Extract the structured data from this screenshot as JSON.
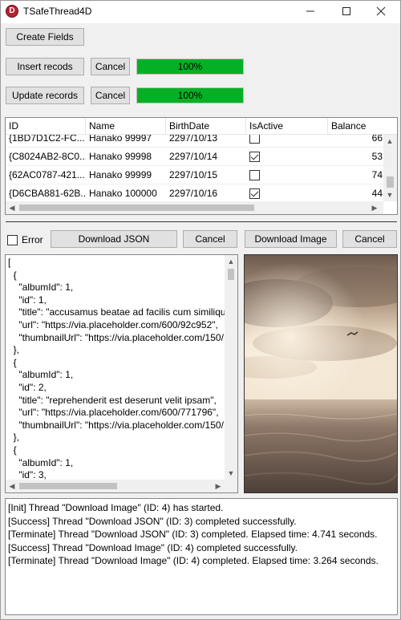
{
  "window": {
    "title": "TSafeThread4D",
    "minimize": "—",
    "maximize": "☐",
    "close": "✕"
  },
  "buttons": {
    "create_fields": "Create Fields",
    "insert_records": "Insert recods",
    "insert_cancel": "Cancel",
    "update_records": "Update records",
    "update_cancel": "Cancel",
    "download_json": "Download JSON",
    "json_cancel": "Cancel",
    "download_image": "Download Image",
    "image_cancel": "Cancel"
  },
  "progress": {
    "insert": {
      "value": 1.0,
      "label": "100%"
    },
    "update": {
      "value": 1.0,
      "label": "100%"
    }
  },
  "grid": {
    "columns": [
      "ID",
      "Name",
      "BirthDate",
      "IsActive",
      "Balance"
    ],
    "rows": [
      {
        "id": "{1BD7D1C2-FC...",
        "name": "Hanako 99997",
        "birthdate": "2297/10/13",
        "active": false,
        "balance": "66"
      },
      {
        "id": "{C8024AB2-8C0...",
        "name": "Hanako 99998",
        "birthdate": "2297/10/14",
        "active": true,
        "balance": "53"
      },
      {
        "id": "{62AC0787-421...",
        "name": "Hanako 99999",
        "birthdate": "2297/10/15",
        "active": false,
        "balance": "74"
      },
      {
        "id": "{D6CBA881-62B...",
        "name": "Hanako 100000",
        "birthdate": "2297/10/16",
        "active": true,
        "balance": "44"
      }
    ]
  },
  "error_checkbox": {
    "label": "Error",
    "checked": false
  },
  "json_text": "[\n  {\n    \"albumId\": 1,\n    \"id\": 1,\n    \"title\": \"accusamus beatae ad facilis cum similique\n    \"url\": \"https://via.placeholder.com/600/92c952\",\n    \"thumbnailUrl\": \"https://via.placeholder.com/150/\n  },\n  {\n    \"albumId\": 1,\n    \"id\": 2,\n    \"title\": \"reprehenderit est deserunt velit ipsam\",\n    \"url\": \"https://via.placeholder.com/600/771796\",\n    \"thumbnailUrl\": \"https://via.placeholder.com/150/\n  },\n  {\n    \"albumId\": 1,\n    \"id\": 3,",
  "log": [
    "[Init] Thread \"Download Image\" (ID: 4) has started.",
    "[Success] Thread \"Download JSON\" (ID: 3) completed successfully.",
    "[Terminate] Thread \"Download JSON\" (ID: 3) completed. Elapsed time: 4.741 seconds.",
    "[Success] Thread \"Download Image\" (ID: 4) completed successfully.",
    "[Terminate] Thread \"Download Image\" (ID: 4) completed. Elapsed time: 3.264 seconds."
  ],
  "colors": {
    "progress_fill": "#06b025",
    "button_face": "#e1e1e1",
    "window_bg": "#f0f0f0"
  },
  "icons": {
    "app": "delphi-logo-icon",
    "scroll_up": "chevron-up-icon",
    "scroll_down": "chevron-down-icon",
    "scroll_left": "chevron-left-icon",
    "scroll_right": "chevron-right-icon"
  }
}
